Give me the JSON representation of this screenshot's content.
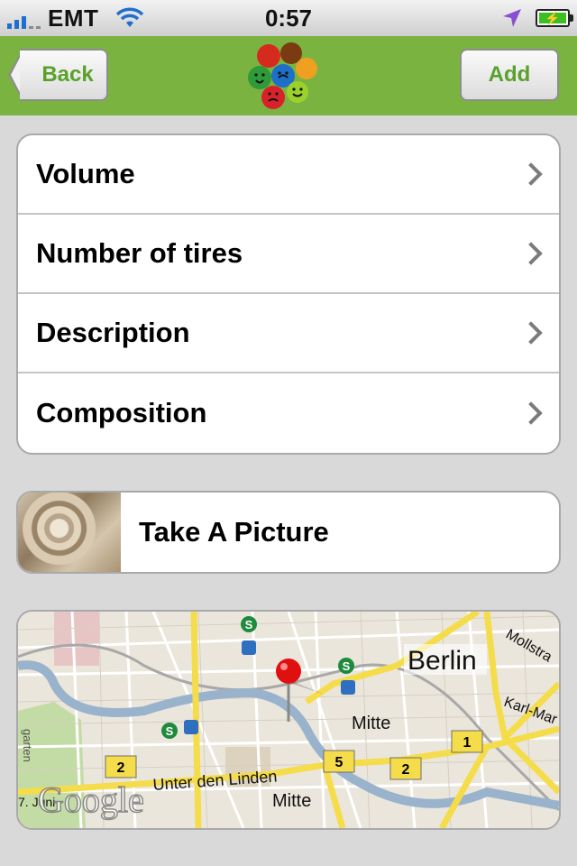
{
  "status_bar": {
    "carrier": "EMT",
    "time": "0:57",
    "signal_bars_active": 3,
    "icons": [
      "signal-bars-icon",
      "wifi-icon",
      "location-arrow-icon",
      "battery-charging-icon"
    ]
  },
  "nav": {
    "back_label": "Back",
    "add_label": "Add",
    "accent_color": "#7bb341",
    "logo": "colored-faces-logo"
  },
  "rows": [
    {
      "label": "Volume"
    },
    {
      "label": "Number of tires"
    },
    {
      "label": "Description"
    },
    {
      "label": "Composition"
    }
  ],
  "picture": {
    "label": "Take A Picture"
  },
  "map": {
    "labels": {
      "city": "Berlin",
      "district_1": "Mitte",
      "district_2": "Mitte",
      "street_1": "Unter den Linden",
      "street_2": "Mollstra",
      "street_3": "Karl-Mar",
      "street_4": "7. Juni",
      "street_5": "garten",
      "brand": "Google"
    },
    "route_badges": [
      "2",
      "5",
      "2",
      "1"
    ],
    "pin_color": "#e01010"
  }
}
